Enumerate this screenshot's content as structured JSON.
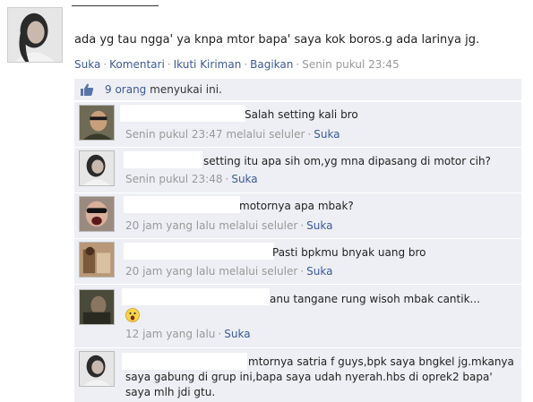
{
  "post": {
    "text": "ada yg tau ngga' ya knpa mtor bapa' saya kok boros.g ada larinya jg.",
    "actions": {
      "like": "Suka",
      "comment": "Komentari",
      "follow": "Ikuti Kiriman",
      "share": "Bagikan",
      "time": "Senin pukul 23:45"
    },
    "likes": {
      "count": "9 orang",
      "text": "menyukai ini."
    }
  },
  "comments": [
    {
      "text": "Salah setting kali bro",
      "time": "Senin pukul 23:47 melalui seluler",
      "like": "Suka"
    },
    {
      "text": "setting itu apa sih om,yg mna dipasang di motor cih?",
      "time": "Senin pukul 23:48",
      "like": "Suka"
    },
    {
      "text": "motornya apa mbak?",
      "time": "20 jam yang lalu melalui seluler",
      "like": "Suka"
    },
    {
      "text": "Pasti bpkmu bnyak uang bro",
      "time": "20 jam yang lalu melalui seluler",
      "like": "Suka"
    },
    {
      "text": "anu tangane rung wisoh mbak cantik...",
      "time": "12 jam yang lalu",
      "like": "Suka"
    },
    {
      "lines": [
        "mtornya satria f guys,bpk saya bngkel jg.mkanya",
        "saya gabung di grup ini,bapa saya udah nyerah.hbs di oprek2 bapa'",
        "saya mlh jdi gtu."
      ]
    }
  ],
  "icons": {
    "like": "thumbs-up-icon",
    "emoji": "surprised-emoticon-icon"
  },
  "colors": {
    "link": "#3b5998",
    "panel": "#edeff4",
    "muted": "#999999"
  }
}
